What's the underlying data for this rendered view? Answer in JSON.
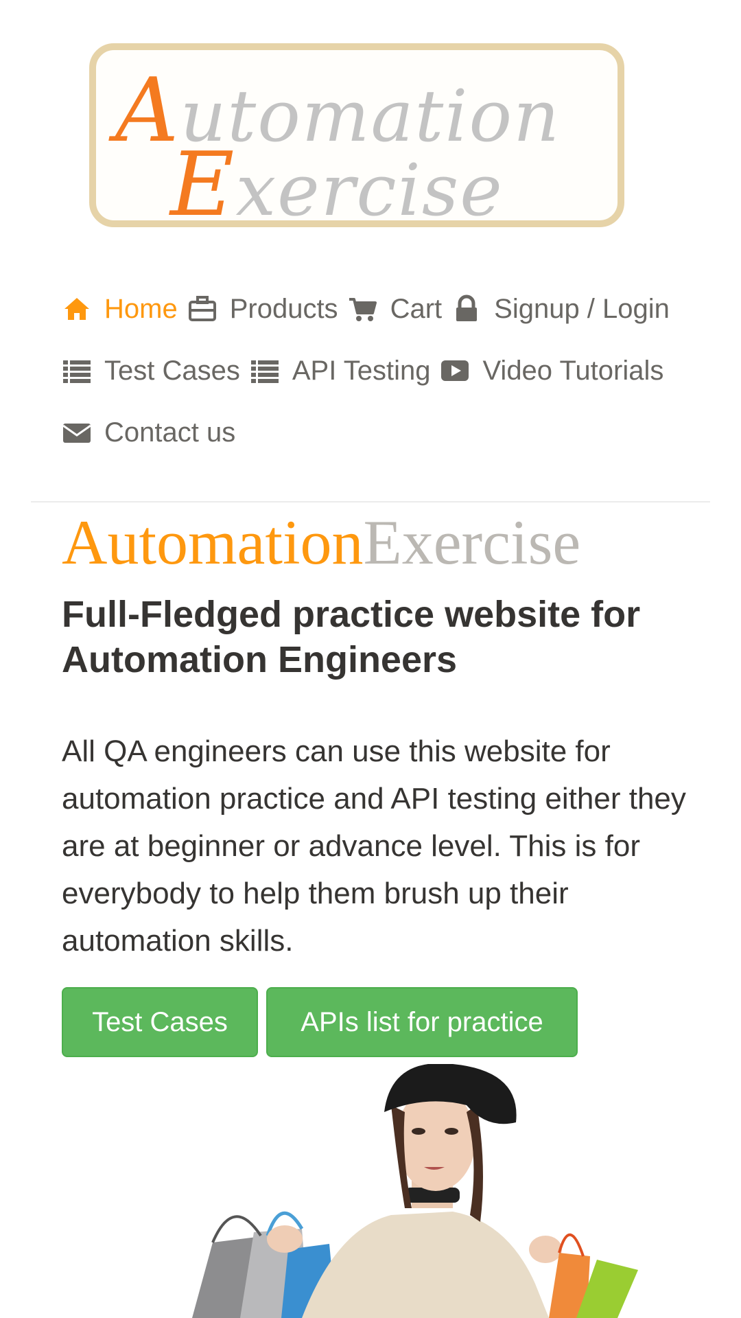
{
  "logo": {
    "line1_cap": "A",
    "line1_rest": "utomation",
    "line2_cap": "E",
    "line2_rest": "xercise"
  },
  "nav": {
    "items": [
      {
        "label": "Home",
        "icon": "home-icon",
        "active": true
      },
      {
        "label": "Products",
        "icon": "briefcase-icon"
      },
      {
        "label": "Cart",
        "icon": "shopping-cart-icon"
      },
      {
        "label": "Signup / Login",
        "icon": "lock-icon"
      },
      {
        "label": "Test Cases",
        "icon": "list-icon"
      },
      {
        "label": "API Testing",
        "icon": "list-icon"
      },
      {
        "label": "Video Tutorials",
        "icon": "youtube-play-icon"
      },
      {
        "label": "Contact us",
        "icon": "envelope-icon"
      }
    ]
  },
  "hero": {
    "brand_part1": "Automation",
    "brand_part2": "Exercise",
    "headline": "Full-Fledged practice website for Automation Engineers",
    "description": "All QA engineers can use this website for automation practice and API testing either they are at beginner or advance level. This is for everybody to help them brush up their automation skills.",
    "buttons": {
      "test_cases": "Test Cases",
      "apis_list": "APIs list for practice"
    }
  },
  "colors": {
    "accent": "#fe980f",
    "nav_text": "#696763",
    "button_green": "#5cb85c",
    "logo_orange": "#f47a20",
    "logo_border": "#e6d3a8"
  }
}
